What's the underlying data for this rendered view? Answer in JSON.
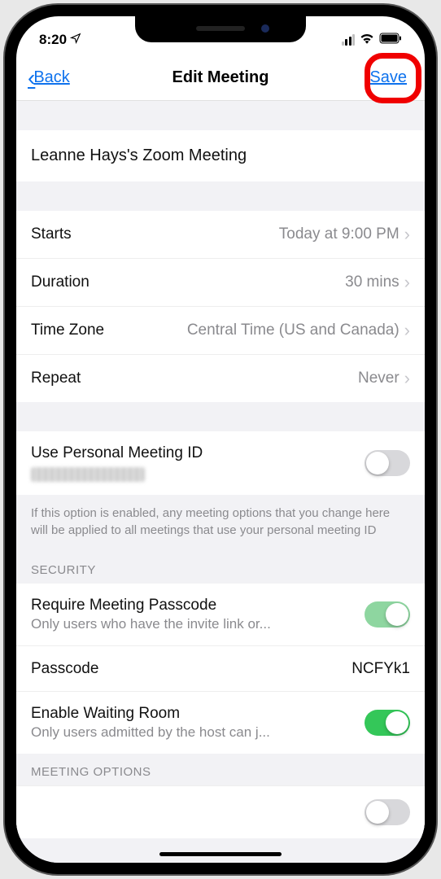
{
  "status": {
    "time": "8:20"
  },
  "nav": {
    "back": "Back",
    "title": "Edit Meeting",
    "save": "Save"
  },
  "meeting": {
    "name": "Leanne Hays's Zoom Meeting"
  },
  "rows": {
    "starts": {
      "label": "Starts",
      "value": "Today at 9:00 PM"
    },
    "duration": {
      "label": "Duration",
      "value": "30 mins"
    },
    "timezone": {
      "label": "Time Zone",
      "value": "Central Time (US and Canada)"
    },
    "repeat": {
      "label": "Repeat",
      "value": "Never"
    }
  },
  "pmi": {
    "label": "Use Personal Meeting ID",
    "footer": "If this option is enabled, any meeting options that you change here will be applied to all meetings that use your personal meeting ID"
  },
  "sections": {
    "security": "SECURITY",
    "meeting_options": "MEETING OPTIONS"
  },
  "security": {
    "passcode_req": {
      "label": "Require Meeting Passcode",
      "sub": "Only users who have the invite link or..."
    },
    "passcode": {
      "label": "Passcode",
      "value": "NCFYk1"
    },
    "waiting": {
      "label": "Enable Waiting Room",
      "sub": "Only users admitted by the host can j..."
    }
  }
}
